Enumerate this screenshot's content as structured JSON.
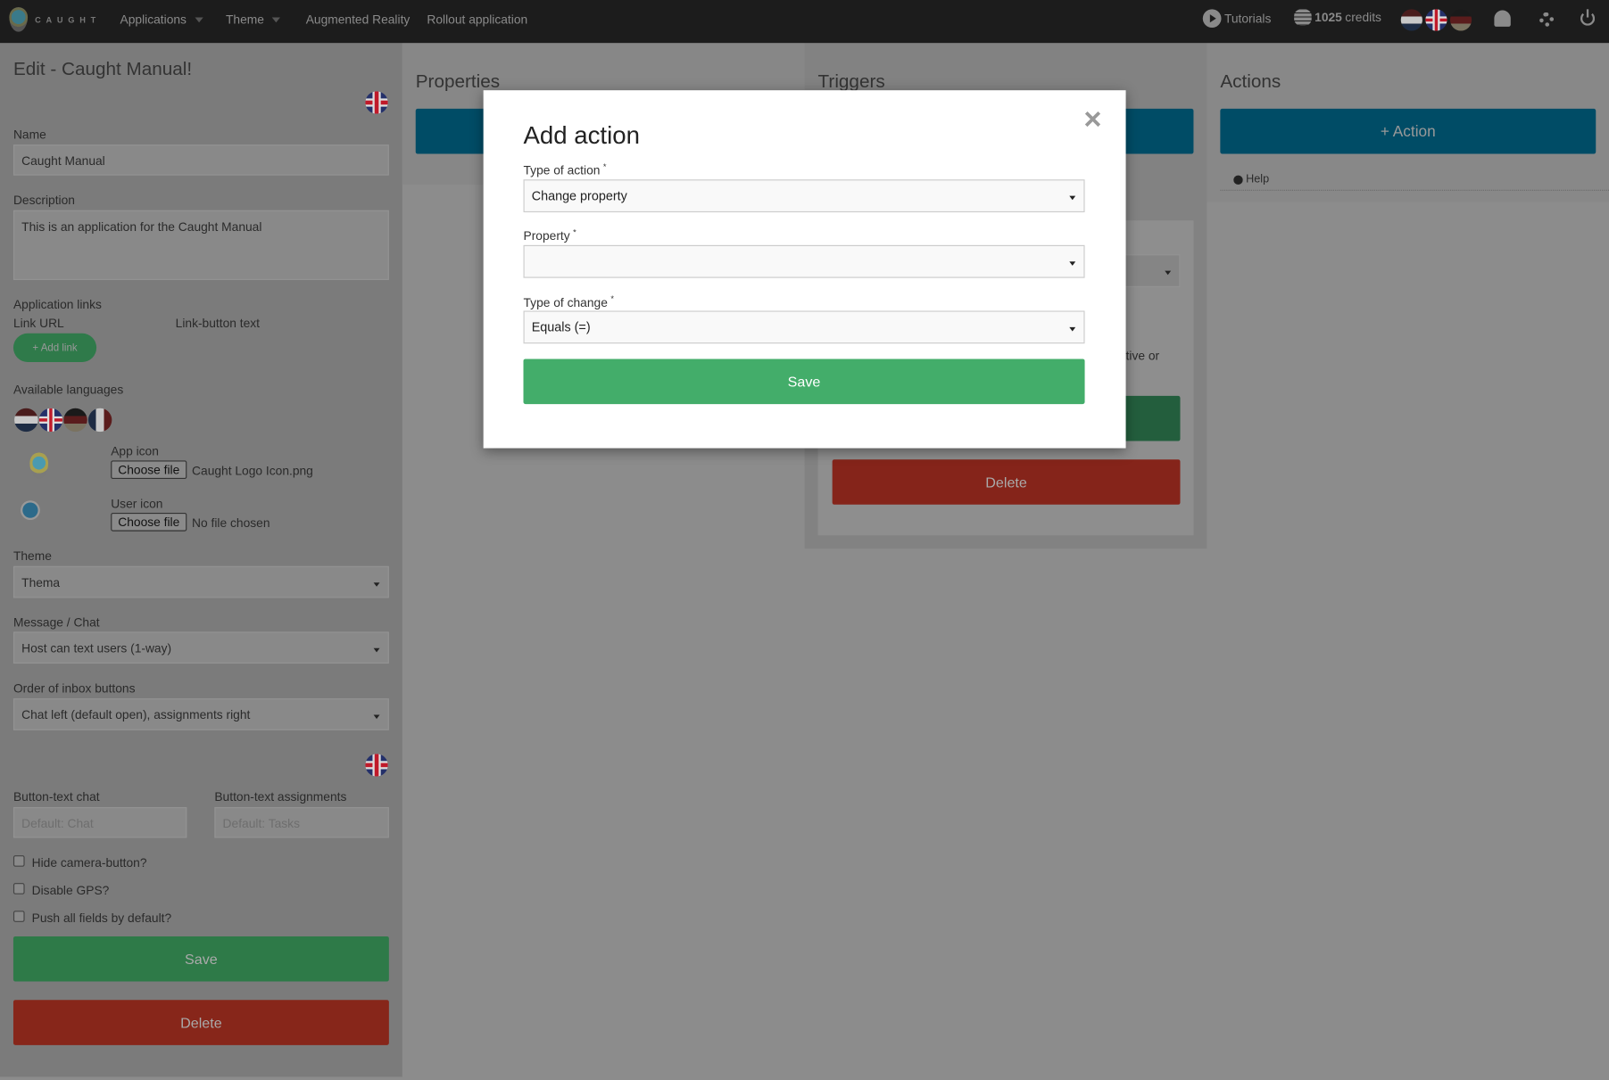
{
  "navbar": {
    "brand": "CAUGHT",
    "menu": [
      {
        "label": "Applications",
        "dropdown": true
      },
      {
        "label": "Theme",
        "dropdown": true
      },
      {
        "label": "Augmented Reality"
      },
      {
        "label": "Rollout application"
      }
    ],
    "tutorials": "Tutorials",
    "credits_amount": "1025",
    "credits_label": "credits",
    "languages": [
      "nl",
      "en",
      "de"
    ],
    "icons": [
      "bell-icon",
      "gear-icon",
      "power-icon"
    ]
  },
  "left": {
    "title": "Edit - Caught Manual!",
    "name_label": "Name",
    "name_value": "Caught Manual",
    "description_label": "Description",
    "description_value": "This is an application for the Caught Manual",
    "app_links_label": "Application links",
    "link_url_label": "Link URL",
    "link_text_label": "Link-button text",
    "add_link": "+ Add link",
    "languages_label": "Available languages",
    "languages": [
      "nl",
      "en",
      "de",
      "fr"
    ],
    "app_icon_label": "App icon",
    "choose_file": "Choose file",
    "app_icon_file": "Caught Logo Icon.png",
    "user_icon_label": "User icon",
    "user_icon_file": "No file chosen",
    "theme_label": "Theme",
    "theme_value": "Thema",
    "chat_label": "Message / Chat",
    "chat_value": "Host can text users (1-way)",
    "inbox_label": "Order of inbox buttons",
    "inbox_value": "Chat left (default open), assignments right",
    "btn_chat_label": "Button-text chat",
    "btn_chat_placeholder": "Default: Chat",
    "btn_assign_label": "Button-text assignments",
    "btn_assign_placeholder": "Default: Tasks",
    "checkboxes": [
      {
        "label": "Hide camera-button?",
        "checked": false
      },
      {
        "label": "Disable GPS?",
        "checked": false
      },
      {
        "label": "Push all fields by default?",
        "checked": false
      }
    ],
    "save": "Save",
    "delete": "Delete"
  },
  "columns": {
    "properties": "Properties",
    "triggers": "Triggers",
    "actions": "Actions",
    "add_action": "+ Action",
    "help": "Help",
    "triggers_partial_text": "tive or",
    "triggers_delete": "Delete"
  },
  "modal": {
    "title": "Add action",
    "close": "×",
    "type_label": "Type of action",
    "type_value": "Change property",
    "property_label": "Property",
    "property_value": "",
    "change_label": "Type of change",
    "change_value": "Equals (=)",
    "required": "*",
    "save": "Save"
  },
  "colors": {
    "primary": "#00506b",
    "success": "#43ad6a",
    "danger": "#c0392b"
  }
}
